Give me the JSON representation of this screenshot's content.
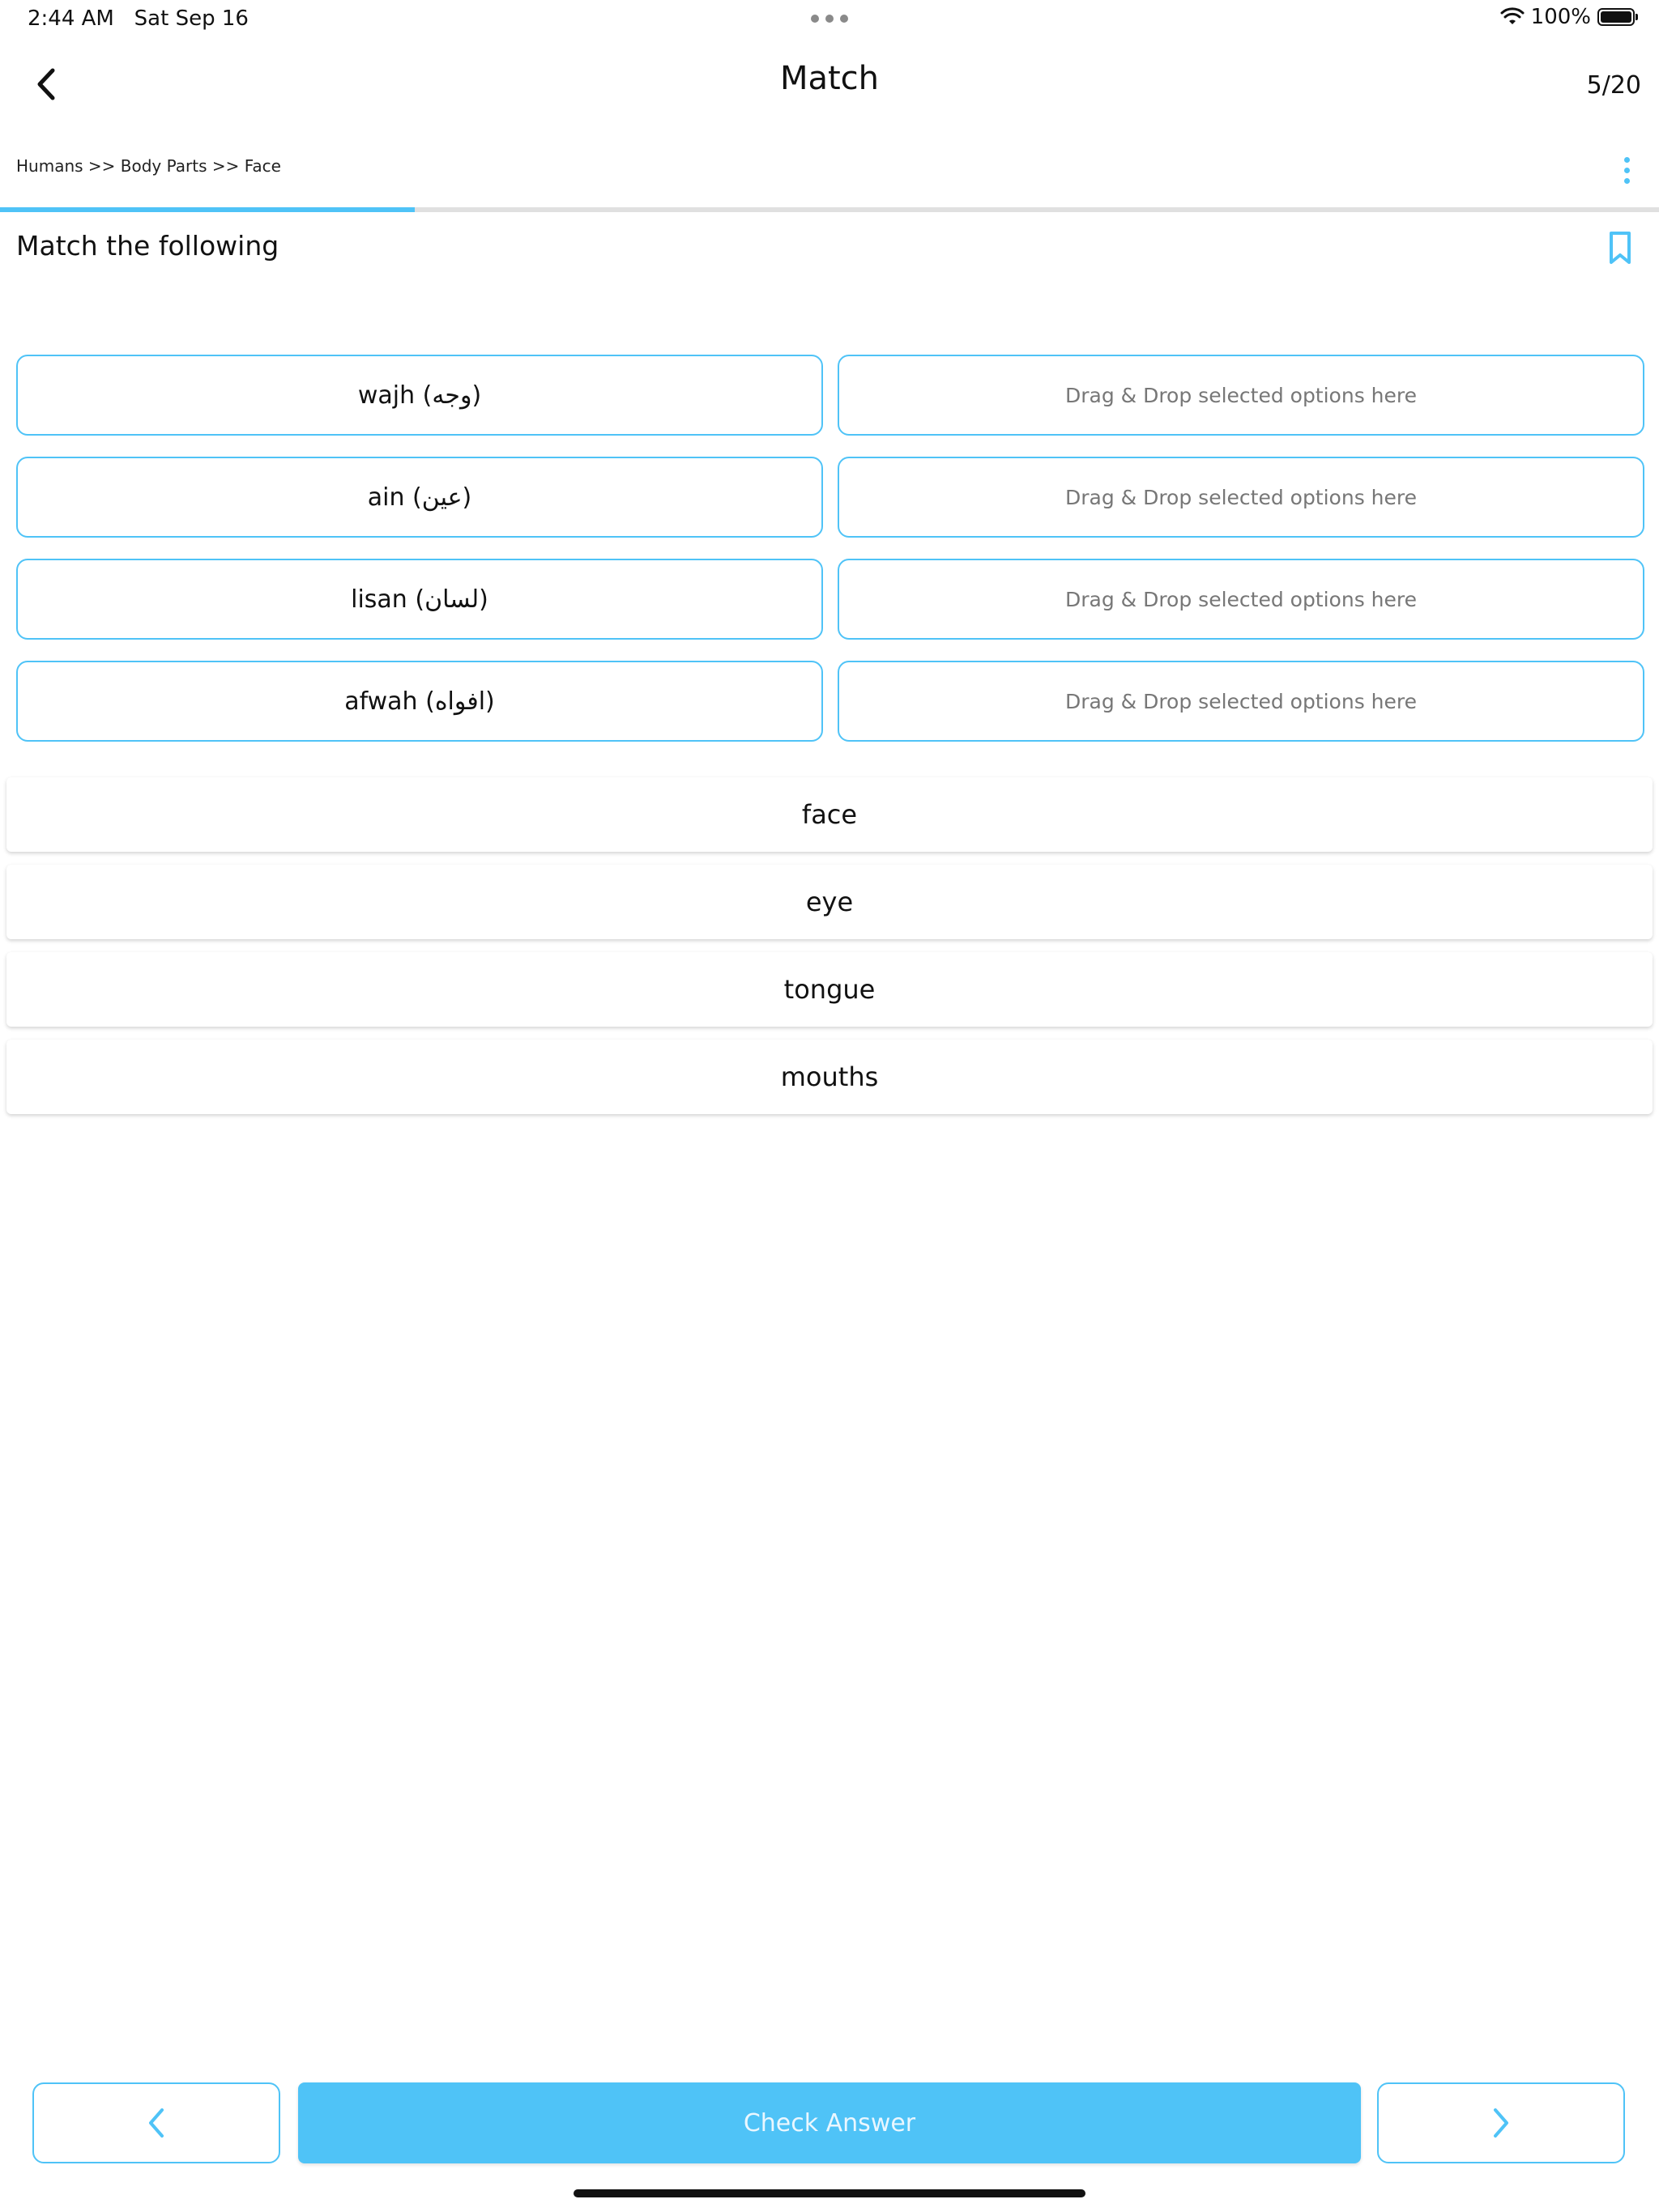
{
  "status_bar": {
    "time": "2:44 AM",
    "date": "Sat Sep 16",
    "battery": "100%"
  },
  "header": {
    "title": "Match",
    "progress": "5/20"
  },
  "breadcrumb": "Humans >> Body Parts >> Face",
  "progress_fraction": 0.25,
  "question": "Match the following",
  "terms": [
    "wajh (وجه)",
    "ain (عين)",
    "lisan (لسان)",
    "afwah (افواه)"
  ],
  "drop_placeholder": "Drag & Drop selected options here",
  "options": [
    "face",
    "eye",
    "tongue",
    "mouths"
  ],
  "buttons": {
    "check_answer": "Check Answer"
  },
  "colors": {
    "accent": "#4fc3f7",
    "track": "#e0e0e0"
  },
  "icons": {
    "back": "chevron-left-icon",
    "menu": "more-vertical-icon",
    "bookmark": "bookmark-icon",
    "prev": "chevron-left-icon",
    "next": "chevron-right-icon"
  }
}
